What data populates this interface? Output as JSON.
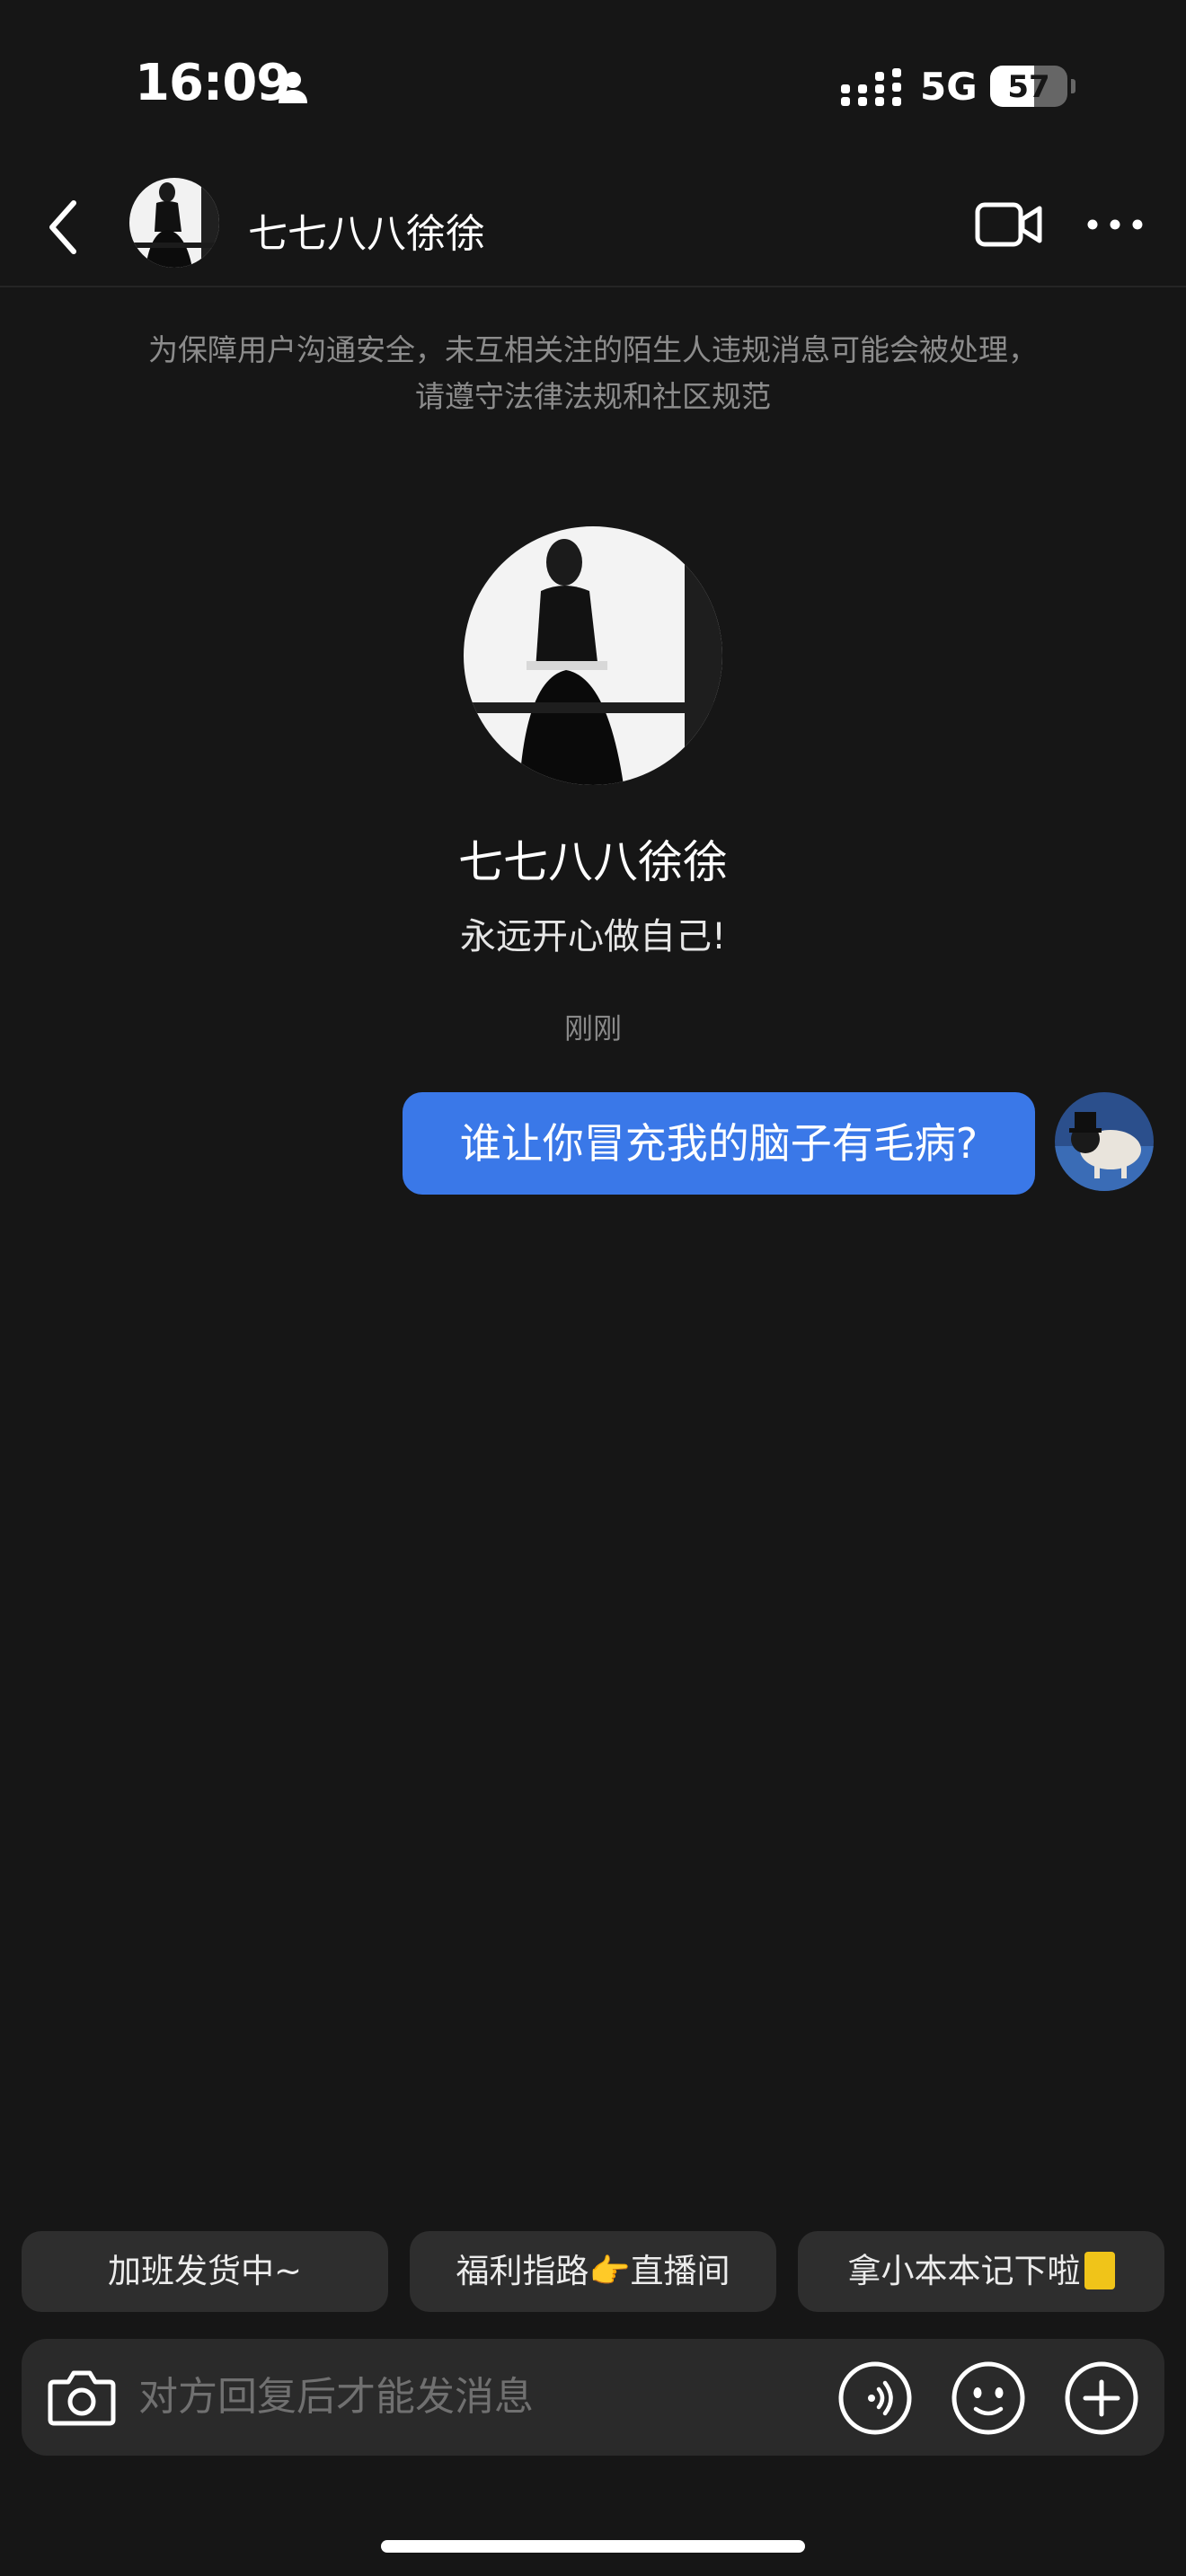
{
  "status_bar": {
    "time": "16:09",
    "network": "5G",
    "battery_level": "57",
    "battery_fraction": 0.57,
    "icons": [
      "person-icon",
      "signal-icon"
    ]
  },
  "nav": {
    "title": "七七八八徐徐",
    "icons": [
      "back-icon",
      "avatar",
      "video-call-icon",
      "more-icon"
    ]
  },
  "notice": "为保障用户沟通安全，未互相关注的陌生人违规消息可能会被处理，请遵守法律法规和社区规范",
  "profile": {
    "name": "七七八八徐徐",
    "bio": "永远开心做自己!"
  },
  "timestamp": "刚刚",
  "messages": [
    {
      "text": "谁让你冒充我的脑子有毛病?",
      "from": "me"
    }
  ],
  "quick_replies": [
    {
      "text": "加班发货中~"
    },
    {
      "text_before": "福利指路",
      "emoji": "👉",
      "text_after": "直播间"
    },
    {
      "text": "拿小本本记下啦",
      "emoji": "notebook-icon"
    }
  ],
  "composer": {
    "placeholder": "对方回复后才能发消息",
    "icons": [
      "camera-icon",
      "voice-icon",
      "emoji-icon",
      "plus-icon"
    ]
  },
  "colors": {
    "background": "#161616",
    "bubble": "#3a78e8",
    "chip": "#2e2e2e",
    "composer": "#2a2a2a",
    "muted_text": "#8c8c8c"
  }
}
